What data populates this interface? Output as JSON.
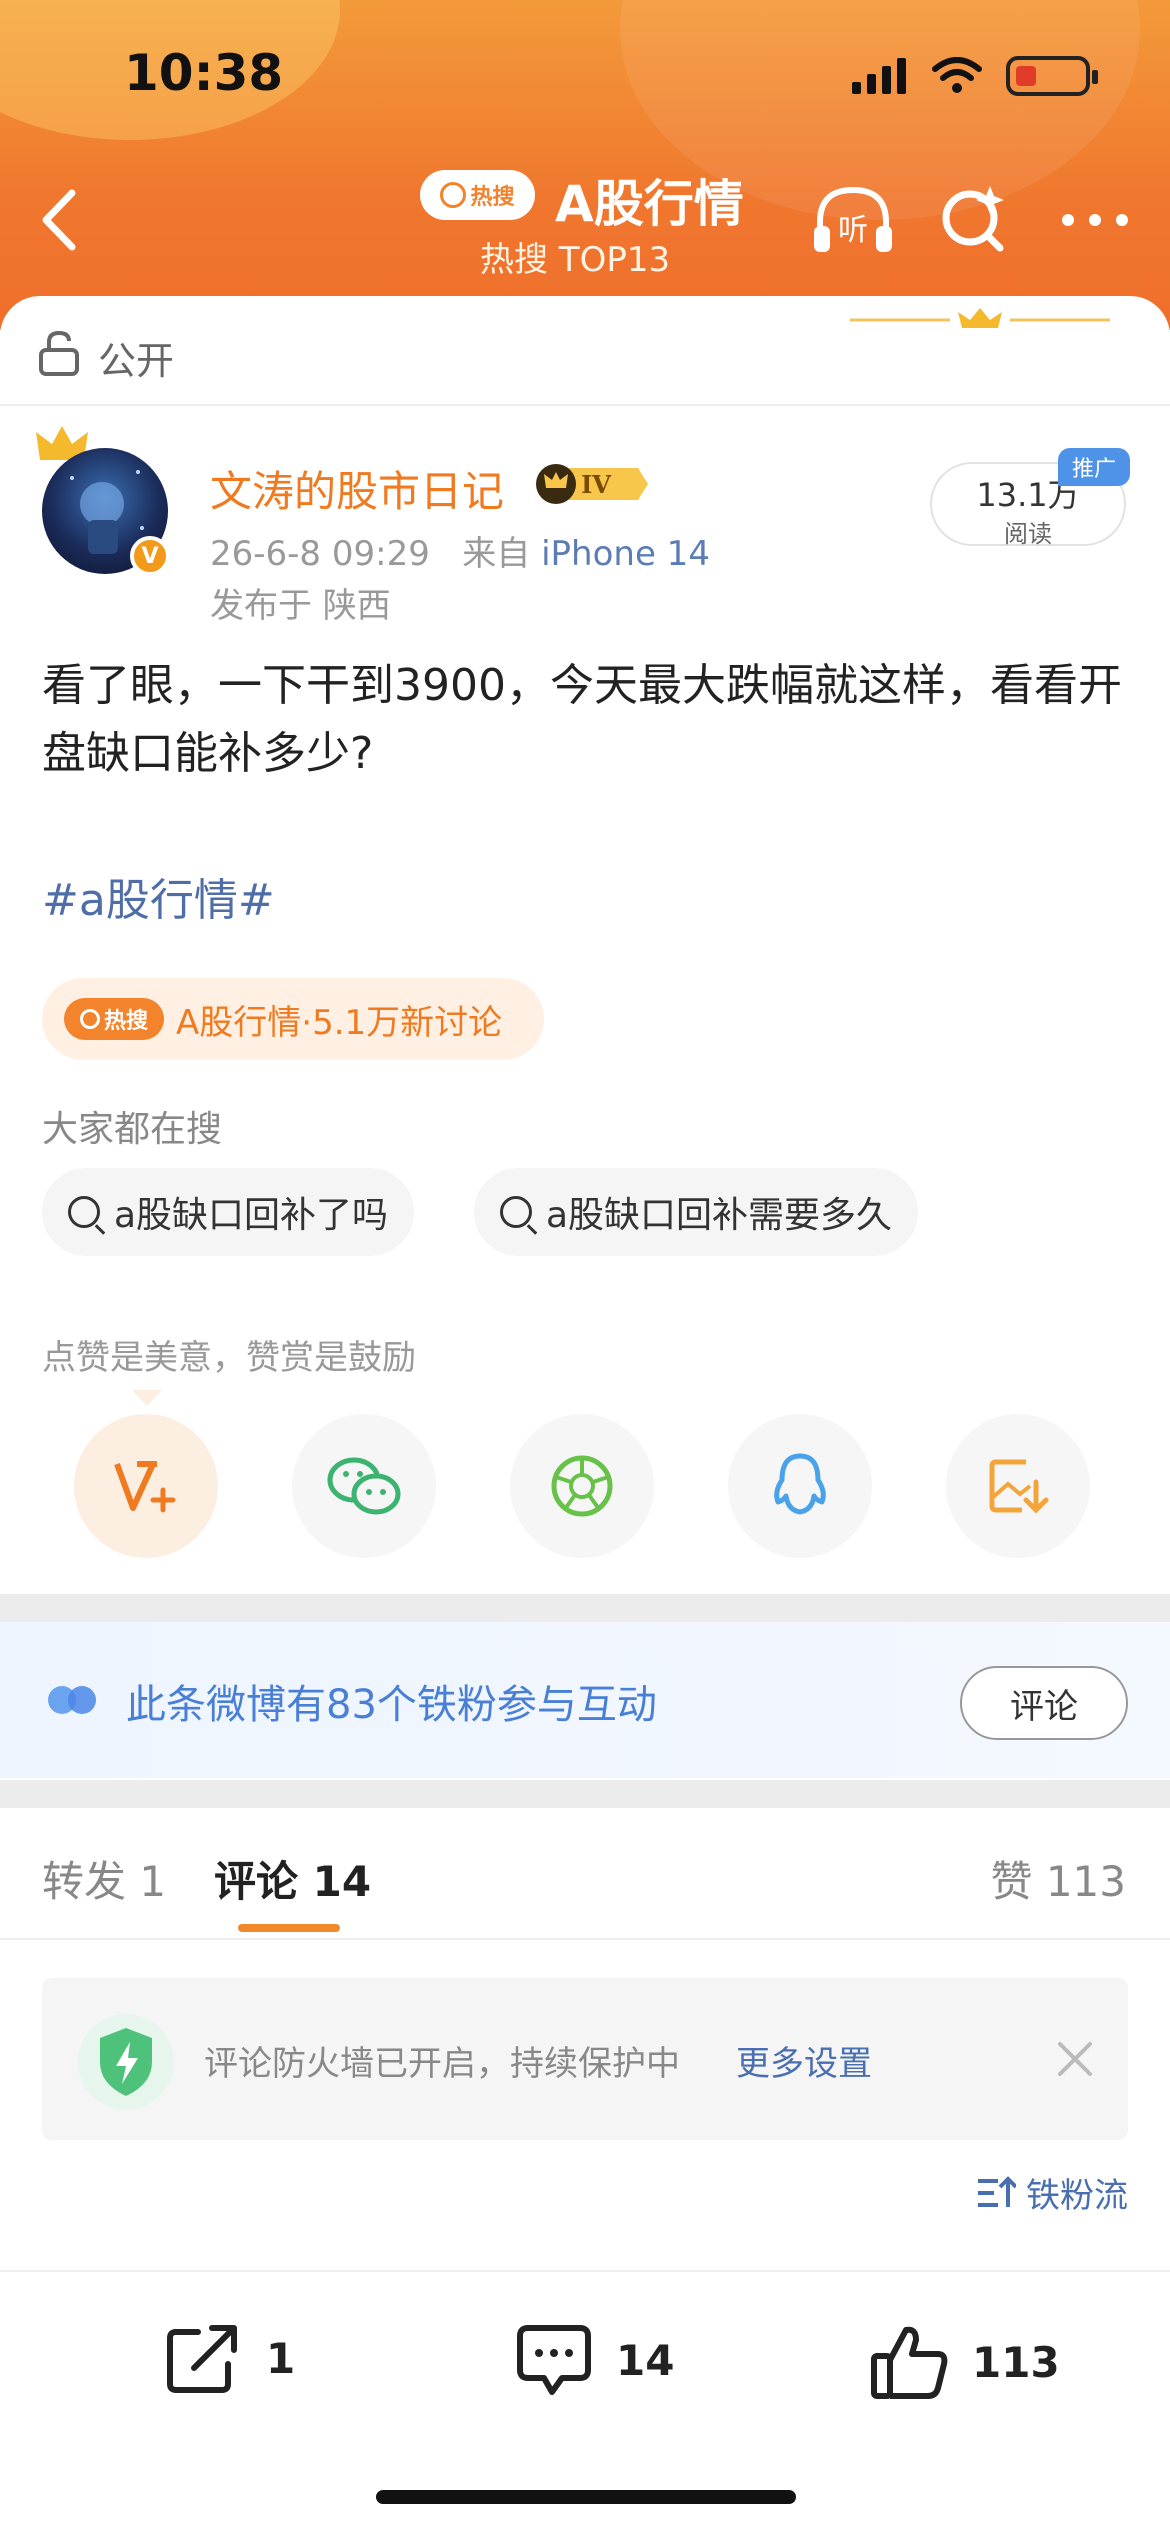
{
  "status_bar": {
    "time": "10:38"
  },
  "header": {
    "hot_badge": "热搜",
    "title": "A股行情",
    "subtitle": "热搜 TOP13",
    "icons": [
      "back-icon",
      "listen-icon",
      "search-icon",
      "more-icon"
    ]
  },
  "visibility": {
    "label": "公开"
  },
  "post": {
    "username": "文涛的股市日记",
    "level": "IV",
    "date": "26-6-8 09:29",
    "source_prefix": "来自",
    "device": "iPhone 14",
    "location": "发布于 陕西",
    "read_count": "13.1万",
    "read_label": "阅读",
    "promo_tag": "推广",
    "verified_badge": "V",
    "text": "看了眼，一下干到3900，今天最大跌幅就这样，看看开盘缺口能补多少?",
    "hashtag": "#a股行情#"
  },
  "hot_topic": {
    "badge": "热搜",
    "text": "A股行情·5.1万新讨论"
  },
  "searches": {
    "label": "大家都在搜",
    "items": [
      "a股缺口回补了吗",
      "a股缺口回补需要多久"
    ]
  },
  "reward": {
    "hint": "点赞是美意，赞赏是鼓励",
    "actions": [
      "reward-icon",
      "wechat-icon",
      "moments-icon",
      "qq-icon",
      "save-image-icon"
    ]
  },
  "fans": {
    "text": "此条微博有83个铁粉参与互动",
    "button": "评论"
  },
  "tabs": {
    "repost": "转发 1",
    "comments": "评论 14",
    "likes": "赞 113"
  },
  "firewall": {
    "text": "评论防火墙已开启，持续保护中",
    "link": "更多设置"
  },
  "sort": {
    "label": "铁粉流"
  },
  "bottom": {
    "repost_count": "1",
    "comment_count": "14",
    "like_count": "113"
  },
  "colors": {
    "accent": "#f07a20",
    "link": "#4a6fb0",
    "header": "#ef7a2e"
  }
}
